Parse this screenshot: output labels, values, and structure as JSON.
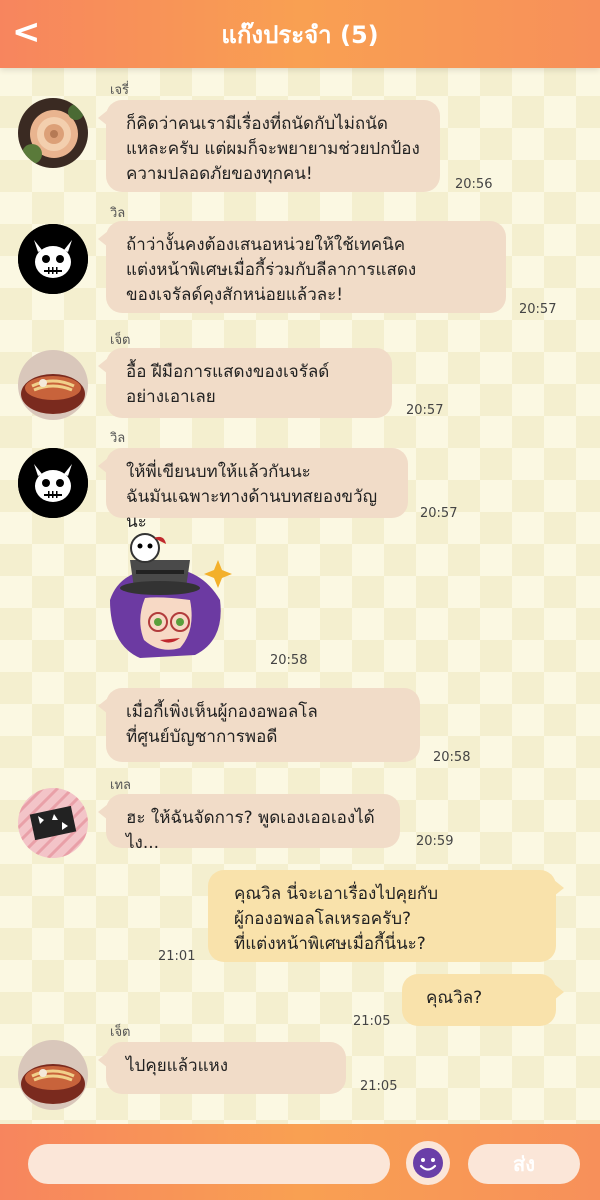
{
  "header": {
    "back_icon": "<",
    "title": "แก๊งประจำ (5)"
  },
  "messages": [
    {
      "sender": "เจรี่",
      "avatar": "rose-avatar",
      "text": [
        "ก็คิดว่าคนเรามีเรื่องที่ถนัดกับไม่ถนัด",
        "แหละครับ แต่ผมก็จะพยายามช่วยปกป้อง",
        "ความปลอดภัยของทุกคน!"
      ],
      "time": "20:56"
    },
    {
      "sender": "วิล",
      "avatar": "skull-avatar",
      "text": [
        "ถ้าว่างั้นคงต้องเสนอหน่วยให้ใช้เทคนิค",
        "แต่งหน้าพิเศษเมื่อกี้ร่วมกับลีลาการแสดง",
        "ของเจรัลด์คุงสักหน่อยแล้วละ!"
      ],
      "time": "20:57"
    },
    {
      "sender": "เจ็ต",
      "avatar": "noodle-avatar",
      "text": [
        "อื้อ ฝีมือการแสดงของเจรัลด์",
        "อย่างเอาเลย"
      ],
      "time": "20:57"
    },
    {
      "sender": "วิล",
      "avatar": "skull-avatar",
      "text": [
        "ให้พี่เขียนบทให้แล้วกันนะ",
        "ฉันมันเฉพาะทางด้านบทสยองขวัญนะ"
      ],
      "time": "20:57"
    },
    {
      "sender": "",
      "avatar": "",
      "sticker": "chibi-sticker",
      "time": "20:58"
    },
    {
      "sender": "",
      "avatar": "",
      "text": [
        "เมื่อกี้เพิ่งเห็นผู้กองอพอลโล",
        "ที่ศูนย์บัญชาการพอดี"
      ],
      "time": "20:58"
    },
    {
      "sender": "เทล",
      "avatar": "tel-avatar",
      "text": [
        "ฮะ ให้ฉันจัดการ? พูดเองเออเองได้ไง..."
      ],
      "time": "20:59"
    },
    {
      "sender": "me",
      "text": [
        "คุณวิล นี่จะเอาเรื่องไปคุยกับ",
        "ผู้กองอพอลโลเหรอครับ?",
        "ที่แต่งหน้าพิเศษเมื่อกี้นี่นะ?"
      ],
      "time": "21:01"
    },
    {
      "sender": "me",
      "text": [
        "คุณวิล?"
      ],
      "time": "21:05"
    },
    {
      "sender": "เจ็ต",
      "avatar": "noodle-avatar",
      "text": [
        "ไปคุยแล้วแหง"
      ],
      "time": "21:05"
    }
  ],
  "footer": {
    "input_placeholder": "",
    "emoji_icon": "smiley-icon",
    "send_label": "ส่ง"
  },
  "colors": {
    "header": "#f8955a",
    "left_bubble": "#f1dcc8",
    "right_bubble": "#f9e2ab",
    "background": "#fbf8e2"
  }
}
